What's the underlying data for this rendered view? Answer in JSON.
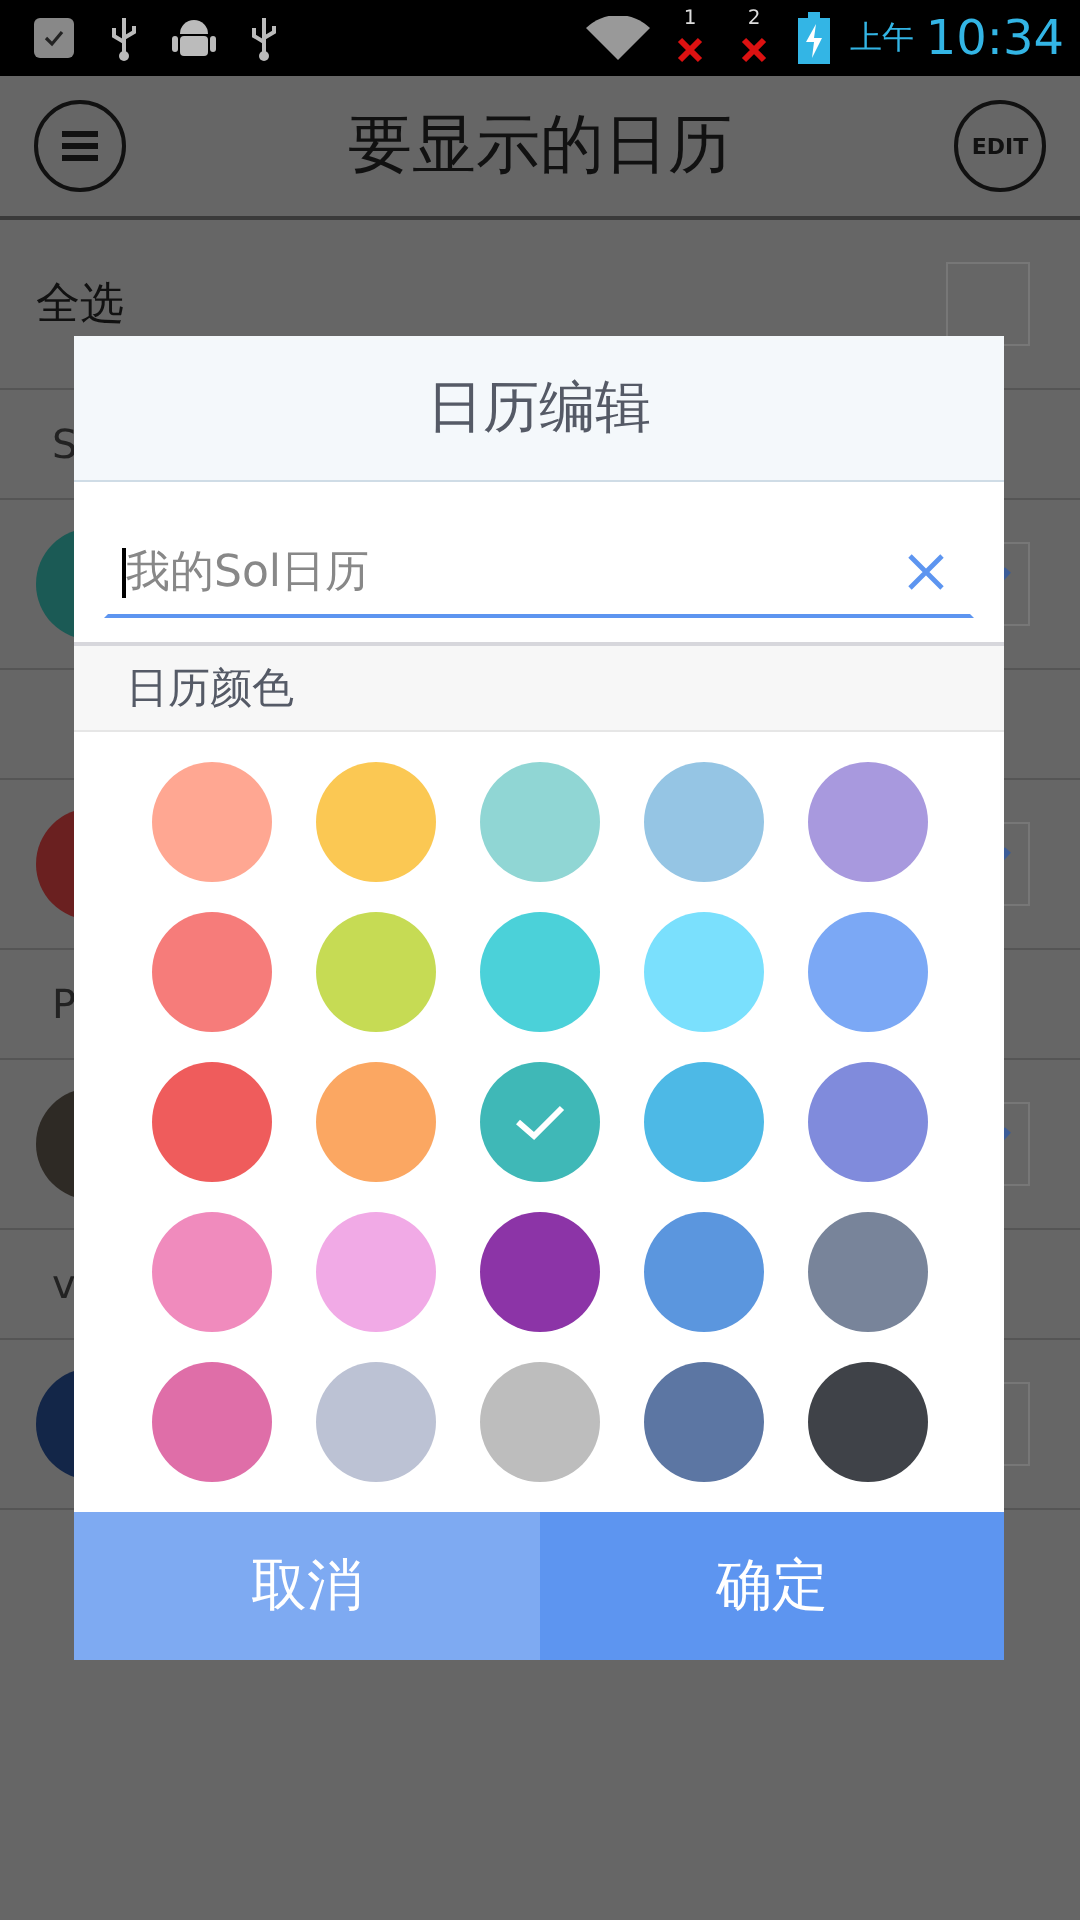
{
  "status_bar": {
    "sim_labels": [
      "1",
      "2"
    ],
    "period": "上午",
    "time": "10:34"
  },
  "header": {
    "title": "要显示的日历",
    "edit_label": "EDIT"
  },
  "select_all": {
    "label": "全选",
    "checked": false
  },
  "groups": [
    {
      "header": "S",
      "calendars": [
        {
          "color": "#1b5a55",
          "checked": true
        }
      ]
    },
    {
      "calendars": [
        {
          "color": "#6a2020",
          "checked": true
        }
      ]
    },
    {
      "header": "P",
      "calendars": [
        {
          "color": "#2e2a25",
          "checked": true
        }
      ]
    },
    {
      "header": "v",
      "calendars": [
        {
          "color": "#132648",
          "checked": false
        }
      ]
    }
  ],
  "dialog": {
    "title": "日历编辑",
    "name_field": {
      "placeholder": "我的Sol日历"
    },
    "color_section": "日历颜色",
    "colors": [
      {
        "color": "#ffa792",
        "selected": false
      },
      {
        "color": "#fbc853",
        "selected": false
      },
      {
        "color": "#90d6d4",
        "selected": false
      },
      {
        "color": "#95c5e4",
        "selected": false
      },
      {
        "color": "#a899de",
        "selected": false
      },
      {
        "color": "#f67c7a",
        "selected": false
      },
      {
        "color": "#c6db54",
        "selected": false
      },
      {
        "color": "#4bd1d9",
        "selected": false
      },
      {
        "color": "#7ae0fd",
        "selected": false
      },
      {
        "color": "#7ba8f5",
        "selected": false
      },
      {
        "color": "#ef5c5c",
        "selected": false
      },
      {
        "color": "#fba762",
        "selected": false
      },
      {
        "color": "#3fb8b7",
        "selected": true
      },
      {
        "color": "#4db9e6",
        "selected": false
      },
      {
        "color": "#808bdc",
        "selected": false
      },
      {
        "color": "#f08bbd",
        "selected": false
      },
      {
        "color": "#f1aae6",
        "selected": false
      },
      {
        "color": "#8c34a7",
        "selected": false
      },
      {
        "color": "#5b96de",
        "selected": false
      },
      {
        "color": "#78849a",
        "selected": false
      },
      {
        "color": "#df6ea8",
        "selected": false
      },
      {
        "color": "#bcc2d4",
        "selected": false
      },
      {
        "color": "#bdbdbd",
        "selected": false
      },
      {
        "color": "#5c76a3",
        "selected": false
      },
      {
        "color": "#3f4248",
        "selected": false
      }
    ],
    "buttons": [
      {
        "kind": "cancel",
        "label": "取消"
      },
      {
        "kind": "confirm",
        "label": "确定"
      }
    ]
  }
}
